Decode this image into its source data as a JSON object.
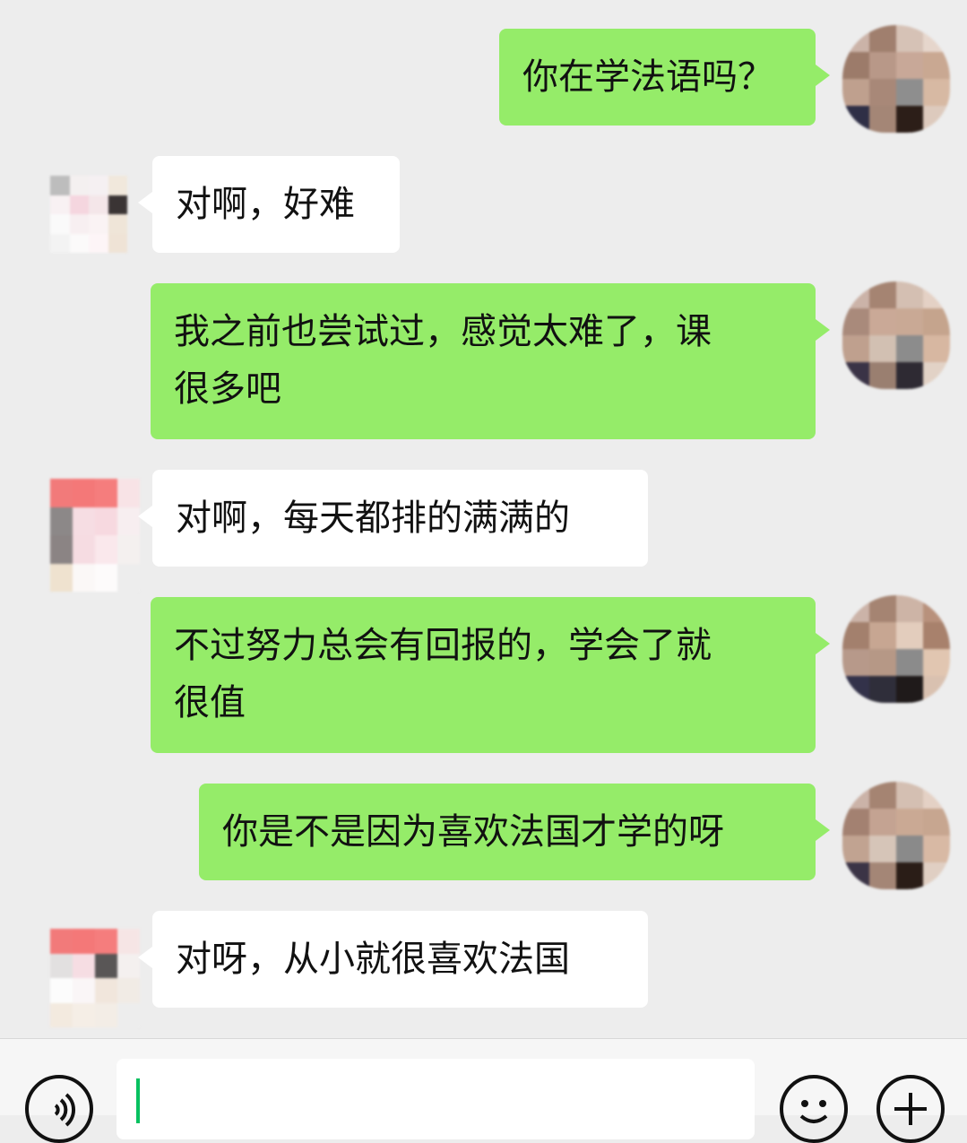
{
  "messages": [
    {
      "side": "me",
      "text": "你在学法语吗？"
    },
    {
      "side": "them",
      "text": "对啊，好难"
    },
    {
      "side": "me",
      "line1": "我之前也尝试过，感觉太难了，课",
      "line2": "很多吧"
    },
    {
      "side": "them",
      "text": "对啊，每天都排的满满的"
    },
    {
      "side": "me",
      "line1": "不过努力总会有回报的，学会了就",
      "line2": "很值"
    },
    {
      "side": "me",
      "text": "你是不是因为喜欢法国才学的呀"
    },
    {
      "side": "them",
      "text": "对呀，从小就很喜欢法国"
    }
  ],
  "input": {
    "value": ""
  },
  "icons": {
    "voice": "voice-icon",
    "emoji": "emoji-icon",
    "plus": "plus-icon"
  },
  "colors": {
    "sent_bubble": "#95ec69",
    "received_bubble": "#ffffff",
    "background": "#ededed",
    "caret": "#07c160"
  }
}
